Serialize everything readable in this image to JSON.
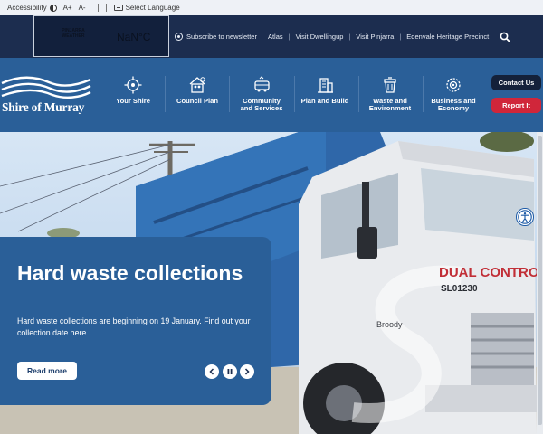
{
  "utility": {
    "accessibility_label": "Accessibility",
    "font_increase": "A+",
    "font_decrease": "A-",
    "language_label": "Select Language"
  },
  "weather": {
    "label_line1": "PINJARRA",
    "label_line2": "WEATHER",
    "value": "NaN°C"
  },
  "top_links": {
    "newsletter": "Subscribe to newsletter",
    "atlas": "Atlas",
    "visit_dwellingup": "Visit Dwellingup",
    "visit_pinjarra": "Visit Pinjarra",
    "edenvale": "Edenvale Heritage Precinct",
    "separator": "|"
  },
  "logo": {
    "text": "Shire of Murray"
  },
  "nav": {
    "items": [
      {
        "label": "Your Shire",
        "icon": "compass-icon"
      },
      {
        "label": "Council Plan",
        "icon": "house-people-icon"
      },
      {
        "label": "Community\nand Services",
        "icon": "community-bus-icon"
      },
      {
        "label": "Plan and Build",
        "icon": "building-plan-icon"
      },
      {
        "label": "Waste and\nEnvironment",
        "icon": "waste-bin-icon"
      },
      {
        "label": "Business and\nEconomy",
        "icon": "business-gear-icon"
      }
    ],
    "contact_label": "Contact Us",
    "report_label": "Report It"
  },
  "hero": {
    "title": "Hard waste collections",
    "description": "Hard waste collections are beginning on 19 January. Find out your collection date here.",
    "button_label": "Read more",
    "truck_text_line1": "DUAL CONTROL",
    "truck_text_line2": "SL01230",
    "truck_name": "Broody"
  },
  "colors": {
    "utility_bg": "#eef1f6",
    "top_bar_bg": "#1c2d4f",
    "nav_bg": "#2a5f98",
    "contact_bg": "#14213a",
    "report_bg": "#d0263a",
    "card_bg": "#2a5f98"
  }
}
